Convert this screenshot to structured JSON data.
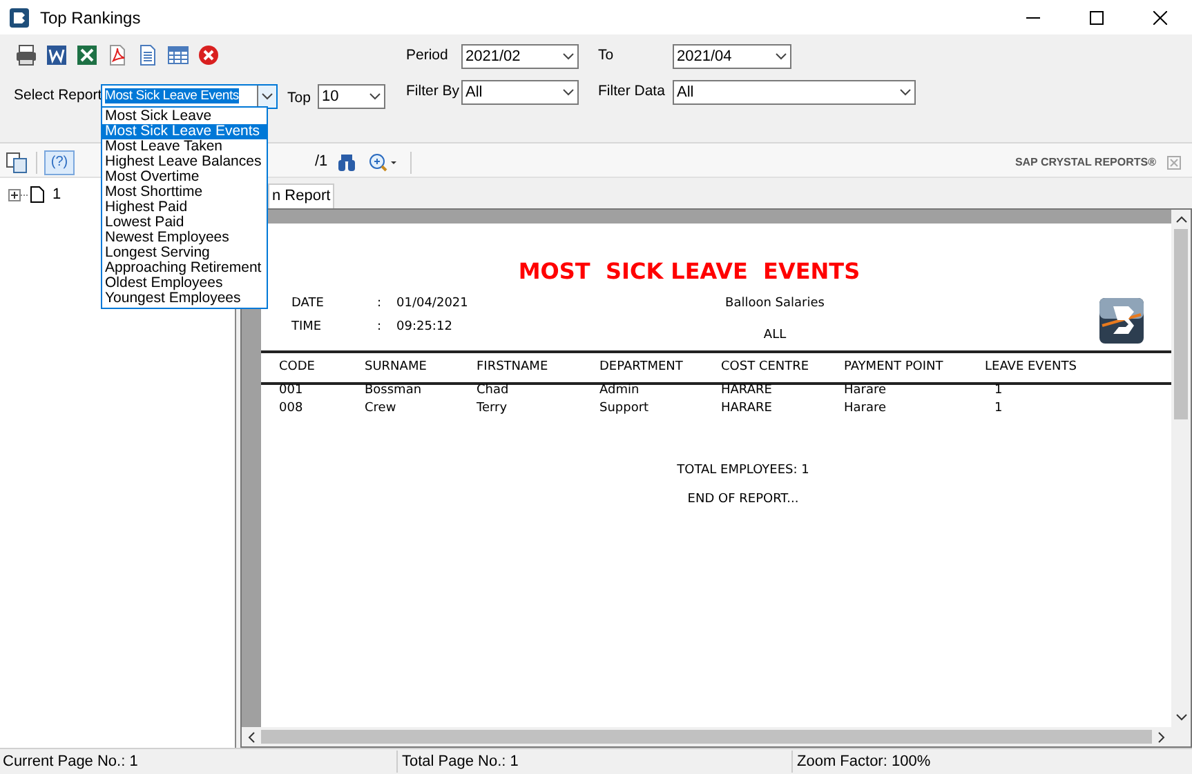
{
  "window": {
    "title": "Top Rankings"
  },
  "form": {
    "select_report": {
      "label": "Select Report",
      "value": "Most Sick Leave Events",
      "expanded": true,
      "options": [
        {
          "label": "Most Sick Leave",
          "selected": false
        },
        {
          "label": "Most Sick Leave Events",
          "selected": true
        },
        {
          "label": "Most Leave Taken",
          "selected": false
        },
        {
          "label": "Highest Leave Balances",
          "selected": false
        },
        {
          "label": "Most Overtime",
          "selected": false
        },
        {
          "label": "Most Shorttime",
          "selected": false
        },
        {
          "label": "Highest Paid",
          "selected": false
        },
        {
          "label": "Lowest Paid",
          "selected": false
        },
        {
          "label": "Newest Employees",
          "selected": false
        },
        {
          "label": "Longest Serving",
          "selected": false
        },
        {
          "label": "Approaching Retirement",
          "selected": false
        },
        {
          "label": "Oldest Employees",
          "selected": false
        },
        {
          "label": "Youngest Employees",
          "selected": false
        }
      ]
    },
    "top": {
      "label": "Top",
      "value": "10"
    },
    "period": {
      "label": "Period",
      "value": "2021/02"
    },
    "to": {
      "label": "To",
      "value": "2021/04"
    },
    "filter_by": {
      "label": "Filter By",
      "value": "All"
    },
    "filter_data": {
      "label": "Filter Data",
      "value": "All"
    }
  },
  "viewer_toolbar": {
    "help": "(?)",
    "page_total": "/1",
    "brand": "SAP CRYSTAL REPORTS®"
  },
  "tree": [
    {
      "label": "1"
    }
  ],
  "tab": {
    "label": "n Report"
  },
  "report": {
    "title": "MOST  SICK LEAVE  EVENTS",
    "company": "Balloon Salaries",
    "filter": "ALL",
    "fields": [
      {
        "label": "DATE",
        "sep": ":",
        "value": "01/04/2021"
      },
      {
        "label": "TIME",
        "sep": ":",
        "value": "09:25:12"
      }
    ],
    "columns": [
      "CODE",
      "SURNAME",
      "FIRSTNAME",
      "DEPARTMENT",
      "COST CENTRE",
      "PAYMENT POINT",
      "LEAVE EVENTS"
    ],
    "rows": [
      [
        "001",
        "Bossman",
        "Chad",
        "Admin",
        "HARARE",
        "Harare",
        "1"
      ],
      [
        "008",
        "Crew",
        "Terry",
        "Support",
        "HARARE",
        "Harare",
        "1"
      ]
    ],
    "total": "TOTAL EMPLOYEES: 1",
    "end": "END OF REPORT..."
  },
  "status_bar": [
    "Current Page No.: 1",
    "Total Page No.: 1",
    "Zoom Factor: 100%"
  ]
}
